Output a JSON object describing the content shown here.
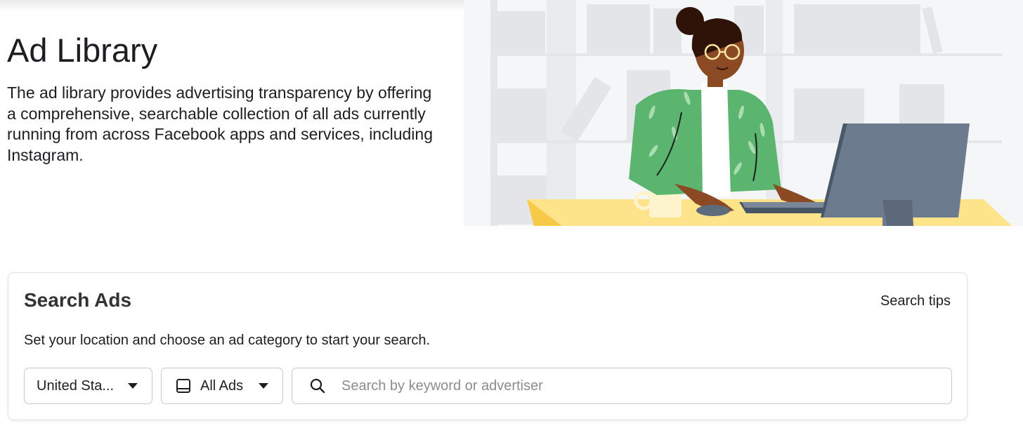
{
  "hero": {
    "title": "Ad Library",
    "description": "The ad library provides advertising transparency by offering a comprehensive, searchable collection of all ads currently running from across Facebook apps and services, including Instagram.",
    "illustration": "woman-at-computer-in-library"
  },
  "search_card": {
    "title": "Search Ads",
    "tips_label": "Search tips",
    "subtitle": "Set your location and choose an ad category to start your search.",
    "country_dropdown": {
      "selected": "United States",
      "icon": "chevron-down-icon"
    },
    "category_dropdown": {
      "selected": "All Ads",
      "icon": "device-icon"
    },
    "search": {
      "placeholder": "Search by keyword or advertiser",
      "value": "",
      "icon": "search-icon"
    }
  },
  "colors": {
    "text": "#1c1e21",
    "placeholder": "#8a8d91",
    "border": "#c6c9cf",
    "cardio_green": "#5bb56e",
    "desk_yellow": "#fde38a",
    "monitor_slate": "#6c7b8e"
  }
}
